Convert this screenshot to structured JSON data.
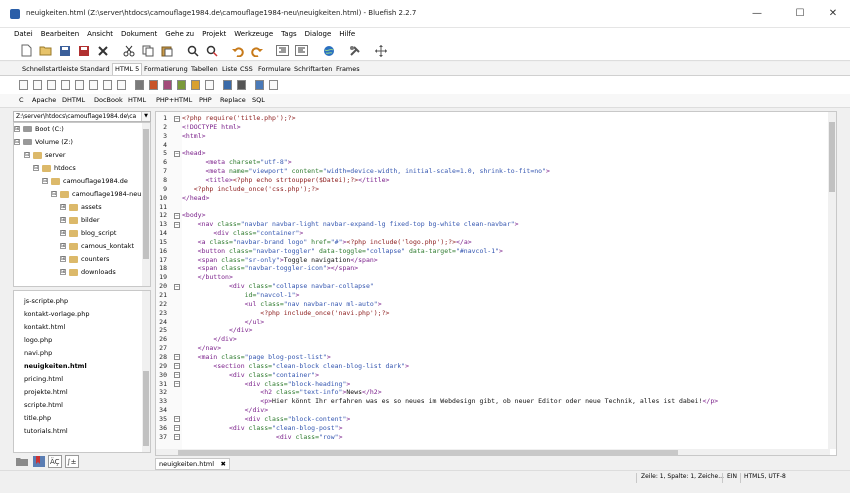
{
  "window": {
    "title": "neuigkeiten.html (Z:\\server\\htdocs\\camouflage1984.de\\camouflage1984-neu\\neuigkeiten.html) - Bluefish 2.2.7"
  },
  "menu": [
    "Datei",
    "Bearbeiten",
    "Ansicht",
    "Dokument",
    "Gehe zu",
    "Projekt",
    "Werkzeuge",
    "Tags",
    "Dialoge",
    "Hilfe"
  ],
  "tabs": [
    "Schnellstartleiste",
    "Standard",
    "HTML 5",
    "Formatierung",
    "Tabellen",
    "Liste",
    "CSS",
    "Formulare",
    "Schriftarten",
    "Frames"
  ],
  "active_tab": "HTML 5",
  "langs": [
    "C",
    "Apache",
    "DHTML",
    "DocBook",
    "HTML",
    "PHP+HTML",
    "PHP",
    "Replace",
    "SQL"
  ],
  "sidebar": {
    "path": "Z:\\server\\htdocs\\camouflage1984.de\\ca",
    "tree": [
      {
        "label": "Boot (C:)",
        "toggle": "⊞"
      },
      {
        "label": "Volume (Z:)",
        "toggle": "⊟"
      },
      {
        "label": "server",
        "toggle": "⊟"
      },
      {
        "label": "htdocs",
        "toggle": "⊟"
      },
      {
        "label": "camouflage1984.de",
        "toggle": "⊟"
      },
      {
        "label": "camouflage1984-neu",
        "toggle": "⊟"
      },
      {
        "label": "assets",
        "toggle": "⊞"
      },
      {
        "label": "bilder",
        "toggle": "⊞"
      },
      {
        "label": "blog_script",
        "toggle": "⊞"
      },
      {
        "label": "camous_kontakt",
        "toggle": "⊞"
      },
      {
        "label": "counters",
        "toggle": "⊞"
      },
      {
        "label": "downloads",
        "toggle": "⊞"
      }
    ],
    "files": [
      "js-scripte.php",
      "kontakt-vorlage.php",
      "kontakt.html",
      "logo.php",
      "navi.php",
      "neuigkeiten.html",
      "pricing.html",
      "projekte.html",
      "scripte.html",
      "title.php",
      "tutorials.html"
    ],
    "selected_file": "neuigkeiten.html"
  },
  "editor": {
    "lines": [
      [
        [
          "c-php",
          "<?php require('title.php');?>"
        ]
      ],
      [
        [
          "c-tag",
          "<!DOCTYPE html>"
        ]
      ],
      [
        [
          "c-tag",
          "<html>"
        ]
      ],
      [],
      [
        [
          "c-tag",
          "<head>"
        ]
      ],
      [
        [
          "c-txt",
          "      "
        ],
        [
          "c-tag",
          "<meta "
        ],
        [
          "c-attr",
          "charset="
        ],
        [
          "c-str",
          "\"utf-8\""
        ],
        [
          "c-tag",
          ">"
        ]
      ],
      [
        [
          "c-txt",
          "      "
        ],
        [
          "c-tag",
          "<meta "
        ],
        [
          "c-attr",
          "name="
        ],
        [
          "c-str",
          "\"viewport\" "
        ],
        [
          "c-attr",
          "content="
        ],
        [
          "c-str",
          "\"width=device-width, initial-scale=1.0, shrink-to-fit=no\""
        ],
        [
          "c-tag",
          ">"
        ]
      ],
      [
        [
          "c-txt",
          "      "
        ],
        [
          "c-tag",
          "<title>"
        ],
        [
          "c-php",
          "<?php echo strtoupper($Datei);?>"
        ],
        [
          "c-tag",
          "</title>"
        ]
      ],
      [
        [
          "c-txt",
          "   "
        ],
        [
          "c-php",
          "<?php include_once('css.php');?>"
        ]
      ],
      [
        [
          "c-tag",
          "</head>"
        ]
      ],
      [],
      [
        [
          "c-tag",
          "<body>"
        ]
      ],
      [
        [
          "c-txt",
          "    "
        ],
        [
          "c-tag",
          "<nav "
        ],
        [
          "c-attr",
          "class="
        ],
        [
          "c-str",
          "\"navbar navbar-light navbar-expand-lg fixed-top bg-white clean-navbar\""
        ],
        [
          "c-tag",
          ">"
        ]
      ],
      [
        [
          "c-txt",
          "        "
        ],
        [
          "c-tag",
          "<div "
        ],
        [
          "c-attr",
          "class="
        ],
        [
          "c-str",
          "\"container\""
        ],
        [
          "c-tag",
          ">"
        ]
      ],
      [
        [
          "c-txt",
          "    "
        ],
        [
          "c-tag",
          "<a "
        ],
        [
          "c-attr",
          "class="
        ],
        [
          "c-str",
          "\"navbar-brand logo\" "
        ],
        [
          "c-attr",
          "href="
        ],
        [
          "c-str",
          "\"#\""
        ],
        [
          "c-tag",
          ">"
        ],
        [
          "c-php",
          "<?php include('logo.php');?>"
        ],
        [
          "c-tag",
          "</a>"
        ]
      ],
      [
        [
          "c-txt",
          "    "
        ],
        [
          "c-tag",
          "<button "
        ],
        [
          "c-attr",
          "class="
        ],
        [
          "c-str",
          "\"navbar-toggler\" "
        ],
        [
          "c-attr",
          "data-toggle="
        ],
        [
          "c-str",
          "\"collapse\" "
        ],
        [
          "c-attr",
          "data-target="
        ],
        [
          "c-str",
          "\"#navcol-1\""
        ],
        [
          "c-tag",
          ">"
        ]
      ],
      [
        [
          "c-txt",
          "    "
        ],
        [
          "c-tag",
          "<span "
        ],
        [
          "c-attr",
          "class="
        ],
        [
          "c-str",
          "\"sr-only\""
        ],
        [
          "c-tag",
          ">"
        ],
        [
          "c-txt",
          "Toggle navigation"
        ],
        [
          "c-tag",
          "</span>"
        ]
      ],
      [
        [
          "c-txt",
          "    "
        ],
        [
          "c-tag",
          "<span "
        ],
        [
          "c-attr",
          "class="
        ],
        [
          "c-str",
          "\"navbar-toggler-icon\""
        ],
        [
          "c-tag",
          "></span>"
        ]
      ],
      [
        [
          "c-txt",
          "    "
        ],
        [
          "c-tag",
          "</button>"
        ]
      ],
      [
        [
          "c-txt",
          "            "
        ],
        [
          "c-tag",
          "<div "
        ],
        [
          "c-attr",
          "class="
        ],
        [
          "c-str",
          "\"collapse navbar-collapse\""
        ]
      ],
      [
        [
          "c-txt",
          "                "
        ],
        [
          "c-attr",
          "id="
        ],
        [
          "c-str",
          "\"navcol-1\""
        ],
        [
          "c-tag",
          ">"
        ]
      ],
      [
        [
          "c-txt",
          "                "
        ],
        [
          "c-tag",
          "<ul "
        ],
        [
          "c-attr",
          "class="
        ],
        [
          "c-str",
          "\"nav navbar-nav ml-auto\""
        ],
        [
          "c-tag",
          ">"
        ]
      ],
      [
        [
          "c-txt",
          "                    "
        ],
        [
          "c-php",
          "<?php include_once('navi.php');?>"
        ]
      ],
      [
        [
          "c-txt",
          "                "
        ],
        [
          "c-tag",
          "</ul>"
        ]
      ],
      [
        [
          "c-txt",
          "            "
        ],
        [
          "c-tag",
          "</div>"
        ]
      ],
      [
        [
          "c-txt",
          "        "
        ],
        [
          "c-tag",
          "</div>"
        ]
      ],
      [
        [
          "c-txt",
          "    "
        ],
        [
          "c-tag",
          "</nav>"
        ]
      ],
      [
        [
          "c-txt",
          "    "
        ],
        [
          "c-tag",
          "<main "
        ],
        [
          "c-attr",
          "class="
        ],
        [
          "c-str",
          "\"page blog-post-list\""
        ],
        [
          "c-tag",
          ">"
        ]
      ],
      [
        [
          "c-txt",
          "        "
        ],
        [
          "c-tag",
          "<section "
        ],
        [
          "c-attr",
          "class="
        ],
        [
          "c-str",
          "\"clean-block clean-blog-list dark\""
        ],
        [
          "c-tag",
          ">"
        ]
      ],
      [
        [
          "c-txt",
          "            "
        ],
        [
          "c-tag",
          "<div "
        ],
        [
          "c-attr",
          "class="
        ],
        [
          "c-str",
          "\"container\""
        ],
        [
          "c-tag",
          ">"
        ]
      ],
      [
        [
          "c-txt",
          "                "
        ],
        [
          "c-tag",
          "<div "
        ],
        [
          "c-attr",
          "class="
        ],
        [
          "c-str",
          "\"block-heading\""
        ],
        [
          "c-tag",
          ">"
        ]
      ],
      [
        [
          "c-txt",
          "                    "
        ],
        [
          "c-tag",
          "<h2 "
        ],
        [
          "c-attr",
          "class="
        ],
        [
          "c-str",
          "\"text-info\""
        ],
        [
          "c-tag",
          ">"
        ],
        [
          "c-txt",
          "News"
        ],
        [
          "c-tag",
          "</h2>"
        ]
      ],
      [
        [
          "c-txt",
          "                    "
        ],
        [
          "c-tag",
          "<p>"
        ],
        [
          "c-txt",
          "Hier könnt Ihr erfahren was es so neues im Webdesign gibt, ob neuer Editor oder neue Technik, alles ist dabei!"
        ],
        [
          "c-tag",
          "</p>"
        ]
      ],
      [
        [
          "c-txt",
          "                "
        ],
        [
          "c-tag",
          "</div>"
        ]
      ],
      [
        [
          "c-txt",
          "                "
        ],
        [
          "c-tag",
          "<div "
        ],
        [
          "c-attr",
          "class="
        ],
        [
          "c-str",
          "\"block-content\""
        ],
        [
          "c-tag",
          ">"
        ]
      ],
      [
        [
          "c-txt",
          "            "
        ],
        [
          "c-tag",
          "<div "
        ],
        [
          "c-attr",
          "class="
        ],
        [
          "c-str",
          "\"clean-blog-post\""
        ],
        [
          "c-tag",
          ">"
        ]
      ],
      [
        [
          "c-txt",
          "                        "
        ],
        [
          "c-tag",
          "<div "
        ],
        [
          "c-attr",
          "class="
        ],
        [
          "c-str",
          "\"row\""
        ],
        [
          "c-tag",
          ">"
        ]
      ]
    ],
    "fold_lines": [
      1,
      5,
      12,
      13,
      20,
      28,
      29,
      30,
      31,
      35,
      36,
      37
    ]
  },
  "doc_tab": "neuigkeiten.html",
  "status": {
    "position": "Zeile: 1, Spalte: 1, Zeiche...",
    "mode": "EIN",
    "encoding": "HTML5, UTF-8"
  }
}
